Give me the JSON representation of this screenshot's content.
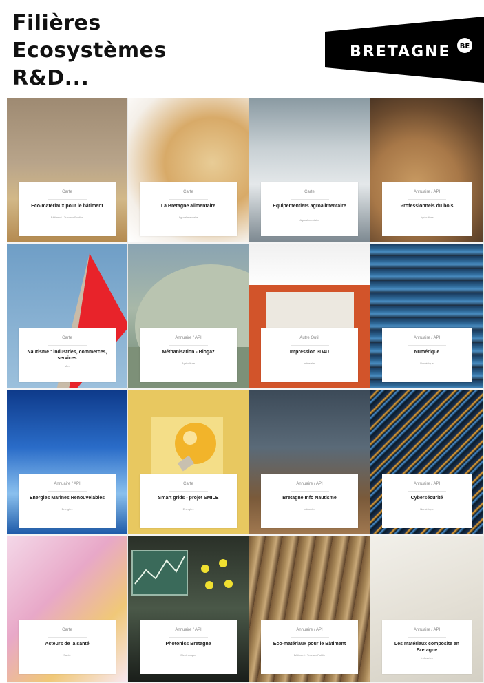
{
  "header": {
    "title_lines": [
      "Filières",
      "Ecosystèmes",
      "R&D..."
    ],
    "logo_text": "BRETAGNE",
    "logo_badge": "BE"
  },
  "tiles": [
    {
      "type": "Carte",
      "name": "Eco-matériaux pour le bâtiment",
      "category": "Bâtiment / Travaux Publics"
    },
    {
      "type": "Carte",
      "name": "La Bretagne alimentaire",
      "category": "Agroalimentaire"
    },
    {
      "type": "Carte",
      "name": "Equipementiers agroalimentaire",
      "category": "Agroalimentaire"
    },
    {
      "type": "Annuaire / API",
      "name": "Professionnels du bois",
      "category": "Agriculture"
    },
    {
      "type": "Carte",
      "name": "Nautisme : industries, commerces, services",
      "category": "Mer"
    },
    {
      "type": "Annuaire / API",
      "name": "Méthanisation - Biogaz",
      "category": "Agriculture"
    },
    {
      "type": "Autre Outil",
      "name": "Impression 3D4U",
      "category": "Industries"
    },
    {
      "type": "Annuaire / API",
      "name": "Numérique",
      "category": "Numérique"
    },
    {
      "type": "Annuaire / API",
      "name": "Energies Marines Renouvelables",
      "category": "Energies"
    },
    {
      "type": "Carte",
      "name": "Smart grids - projet SMILE",
      "category": "Energies"
    },
    {
      "type": "Annuaire / API",
      "name": "Bretagne Info Nautisme",
      "category": "Industries"
    },
    {
      "type": "Annuaire / API",
      "name": "Cybersécurité",
      "category": "Numérique"
    },
    {
      "type": "Carte",
      "name": "Acteurs de la santé",
      "category": "Santé"
    },
    {
      "type": "Annuaire / API",
      "name": "Photonics Bretagne",
      "category": "Electronique"
    },
    {
      "type": "Annuaire / API",
      "name": "Eco-matériaux pour le Bâtiment",
      "category": "Bâtiment / Travaux Public"
    },
    {
      "type": "Annuaire / API",
      "name": "Les matériaux composite en Bretagne",
      "category": "Industries"
    }
  ]
}
